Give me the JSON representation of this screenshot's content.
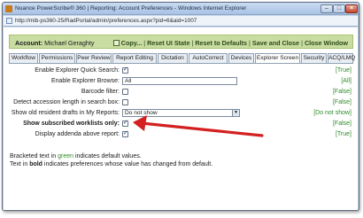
{
  "window": {
    "title": "Nuance PowerScribe® 360 | Reporting: Account Preferences - Windows Internet Explorer",
    "url": "http://mib-ps360-25/RadPortal/admin/preferences.aspx?pid=6&aid=1007"
  },
  "account": {
    "label": "Account:",
    "name": "Michael Geraghty",
    "links": [
      "Copy...",
      "Reset UI State",
      "Reset to Defaults",
      "Save and Close",
      "Close Window"
    ]
  },
  "tabs": [
    "Workflow",
    "Permissions",
    "Peer Review",
    "Report Editing",
    "Dictation",
    "AutoCorrect",
    "Devices",
    "Explorer Screen",
    "Security",
    "ACQ/LMQ"
  ],
  "active_tab": "Explorer Screen",
  "preferences": [
    {
      "label": "Enable Explorer Quick Search:",
      "type": "checkbox",
      "checked": true,
      "default": "[True]"
    },
    {
      "label": "Enable Explorer Browse:",
      "type": "input",
      "value": "All",
      "default": "[All]"
    },
    {
      "label": "Barcode filter:",
      "type": "checkbox",
      "checked": false,
      "default": "[False]"
    },
    {
      "label": "Detect accession length in search box:",
      "type": "checkbox",
      "checked": false,
      "default": "[False]"
    },
    {
      "label": "Show old resident drafts in My Reports:",
      "type": "select",
      "value": "Do not show",
      "default": "[Do not show]"
    },
    {
      "label": "Show subscribed worklists only:",
      "type": "checkbox",
      "checked": true,
      "default": "[False]",
      "changed": true
    },
    {
      "label": "Display addenda above report:",
      "type": "checkbox",
      "checked": true,
      "default": "[True]"
    }
  ],
  "legend": {
    "line1_pre": "Bracketed text in ",
    "line1_green": "green",
    "line1_post": " indicates default values.",
    "line2_pre": "Text in ",
    "line2_bold": "bold",
    "line2_post": " indicates preferences whose value has changed from default."
  },
  "colors": {
    "account_bar": "#c9dda2",
    "default_text": "#2f8a2a",
    "annotation_arrow": "#d42020"
  },
  "icons": [
    "ie-app-icon",
    "page-icon",
    "copy-icon",
    "minimize-icon",
    "maximize-icon",
    "close-icon",
    "dropdown-arrow-icon",
    "red-arrow-annotation"
  ]
}
